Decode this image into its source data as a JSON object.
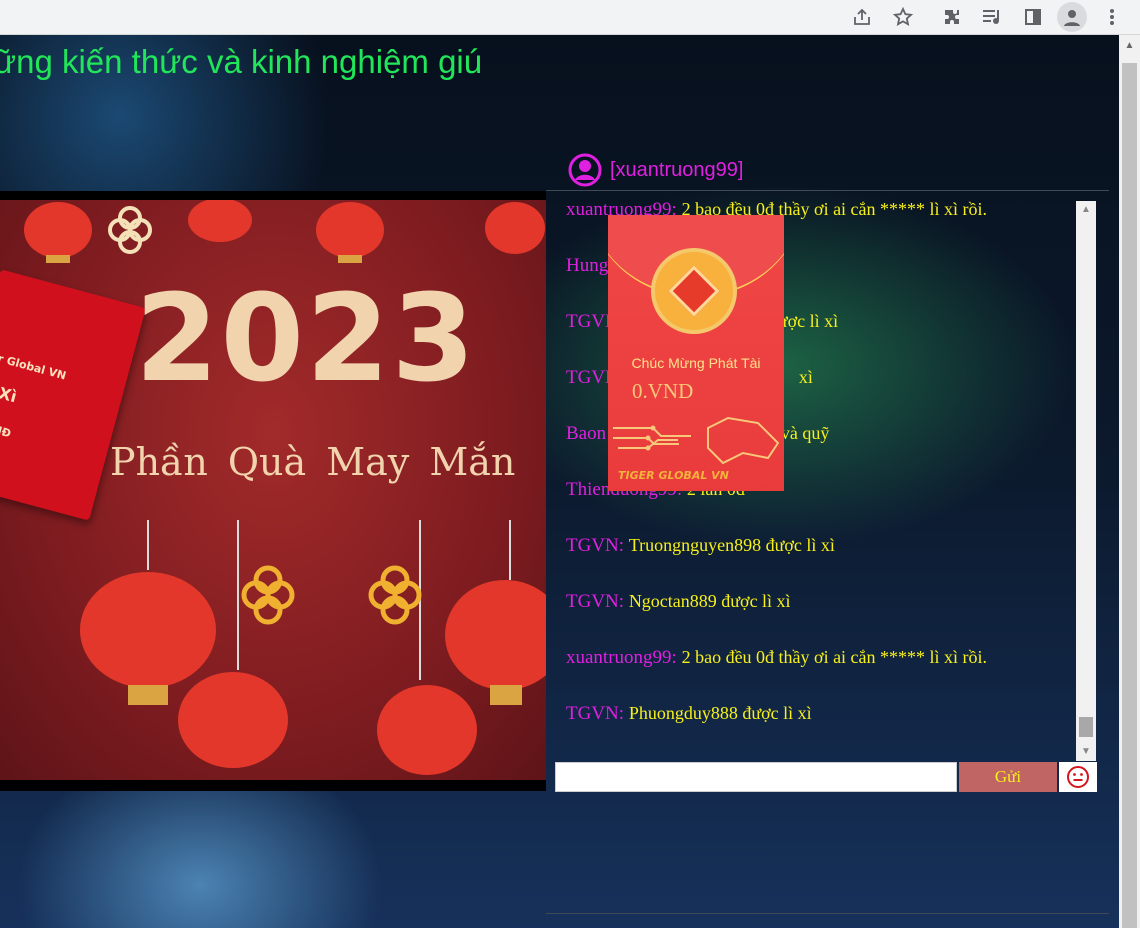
{
  "browser": {
    "icons": [
      "share-icon",
      "bookmark-star-icon",
      "extensions-icon",
      "media-control-icon",
      "side-panel-icon",
      "profile-icon",
      "menu-icon"
    ]
  },
  "marquee": {
    "text": "ững kiến thức và kinh nghiệm giú"
  },
  "banner": {
    "year": "2023",
    "subtitle": "Phần Quà May Mắn",
    "envelope_brand": "r Global VN",
    "envelope_line1": "Xì",
    "envelope_line2": "VNĐ"
  },
  "chat": {
    "current_user": "[xuantruong99]",
    "messages": [
      {
        "nick": "xuantruong99:",
        "text": "2 bao đều 0đ thầy ơi ai cắn ***** lì xì rồi."
      },
      {
        "nick": "Hung",
        "text": ""
      },
      {
        "nick": "TGVN:",
        "text": "được lì xì"
      },
      {
        "nick": "TGVN:",
        "text": "xì"
      },
      {
        "nick": "Baon",
        "text": "và quỹ"
      },
      {
        "nick": "Thienduong99:",
        "text": "2 lần 0đ"
      },
      {
        "nick": "TGVN:",
        "text": "Truongnguyen898 được lì xì"
      },
      {
        "nick": "TGVN:",
        "text": "Ngoctan889 được lì xì"
      },
      {
        "nick": "xuantruong99:",
        "text": "2 bao đều 0đ thầy ơi ai cắn ***** lì xì rồi."
      },
      {
        "nick": "TGVN:",
        "text": "Phuongduy888 được lì xì"
      }
    ],
    "input_value": "",
    "send_label": "Gửi",
    "emoji_icon": "smiley-icon"
  },
  "popup": {
    "title": "Chúc Mừng Phát Tài",
    "amount": "0.VND",
    "brand": "TIGER GLOBAL VN"
  },
  "colors": {
    "marquee": "#22e65a",
    "nick": "#e020e0",
    "message": "#f7f01a",
    "send_button": "#c16464",
    "envelope_red": "#e93b3b"
  }
}
